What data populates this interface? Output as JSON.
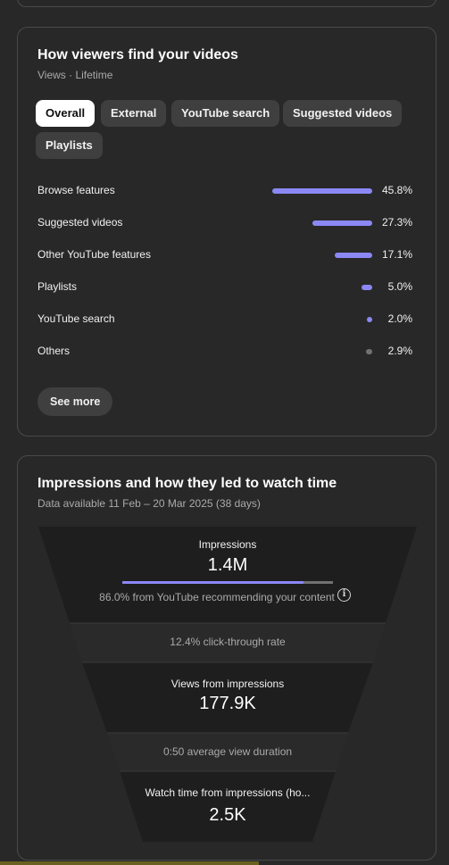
{
  "traffic_sources": {
    "title": "How viewers find your videos",
    "subtitle": "Views · Lifetime",
    "tabs": [
      {
        "label": "Overall",
        "active": true
      },
      {
        "label": "External",
        "active": false
      },
      {
        "label": "YouTube search",
        "active": false
      },
      {
        "label": "Suggested videos",
        "active": false
      },
      {
        "label": "Playlists",
        "active": false
      }
    ],
    "sources": [
      {
        "label": "Browse features",
        "percent": "45.8%",
        "share": 0.458
      },
      {
        "label": "Suggested videos",
        "percent": "27.3%",
        "share": 0.273
      },
      {
        "label": "Other YouTube features",
        "percent": "17.1%",
        "share": 0.171
      },
      {
        "label": "Playlists",
        "percent": "5.0%",
        "share": 0.05
      },
      {
        "label": "YouTube search",
        "percent": "2.0%",
        "share": 0.02
      },
      {
        "label": "Others",
        "percent": "2.9%",
        "share": 0.029
      }
    ],
    "see_more_label": "See more",
    "accent_color": "#8b88f5",
    "muted_color": "#717171"
  },
  "impressions": {
    "title": "Impressions and how they led to watch time",
    "subtitle": "Data available 11 Feb – 20 Mar 2025 (38 days)",
    "impressions_label": "Impressions",
    "impressions_value": "1.4M",
    "recommended_share": 0.86,
    "recommended_text": "86.0% from YouTube recommending your content",
    "ctr_text": "12.4% click-through rate",
    "views_label": "Views from impressions",
    "views_value": "177.9K",
    "avg_duration_text": "0:50 average view duration",
    "watch_time_label": "Watch time from impressions (ho...",
    "watch_time_value": "2.5K"
  }
}
